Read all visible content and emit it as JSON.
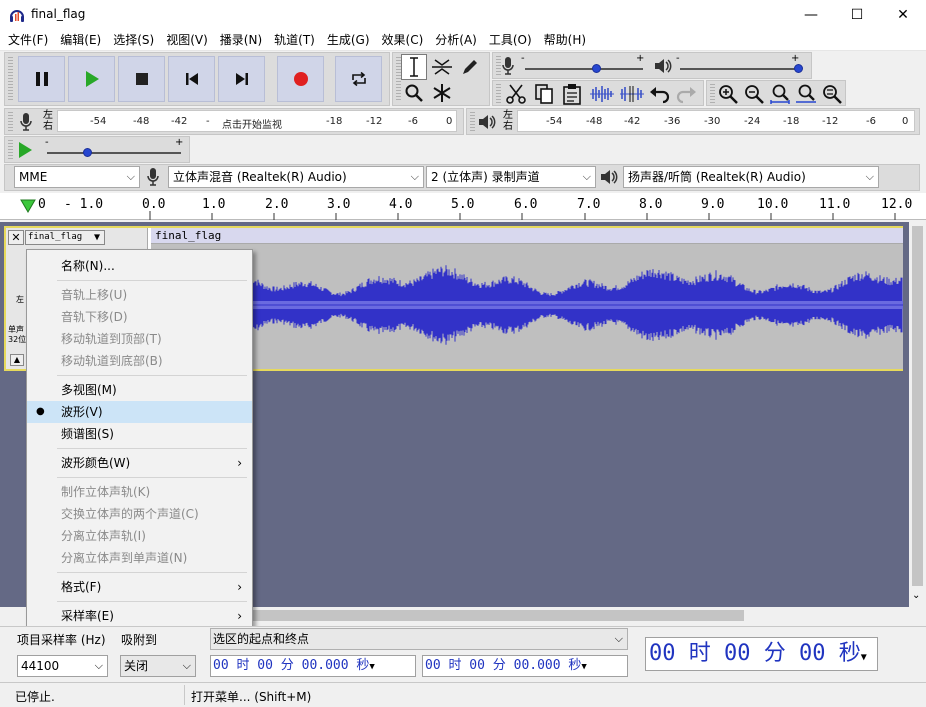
{
  "window": {
    "title": "final_flag",
    "minimize_glyph": "—",
    "maximize_glyph": "☐",
    "close_glyph": "✕"
  },
  "menu": [
    "文件(F)",
    "编辑(E)",
    "选择(S)",
    "视图(V)",
    "播录(N)",
    "轨道(T)",
    "生成(G)",
    "效果(C)",
    "分析(A)",
    "工具(O)",
    "帮助(H)"
  ],
  "meters": {
    "record": {
      "lr": "左右",
      "prompt": "点击开始监视",
      "ticks": [
        "-54",
        "-48",
        "-42",
        "-",
        "-18",
        "-12",
        "-6",
        "0"
      ]
    },
    "play": {
      "lr": "左右",
      "ticks": [
        "-54",
        "-48",
        "-42",
        "-36",
        "-30",
        "-24",
        "-18",
        "-12",
        "-6",
        "0"
      ]
    }
  },
  "mixer": {
    "minus": "-",
    "plus": "+",
    "record_level": 0.6,
    "play_level": 1.0,
    "speed_level": 0.3
  },
  "devices": {
    "host": "MME",
    "recording_device": "立体声混音 (Realtek(R) Audio)",
    "channels": "2 (立体声) 录制声道",
    "playback_device": "扬声器/听筒 (Realtek(R) Audio)"
  },
  "timeline": {
    "labels": [
      "0",
      "- 1.0",
      "0.0",
      "1.0",
      "2.0",
      "3.0",
      "4.0",
      "5.0",
      "6.0",
      "7.0",
      "8.0",
      "9.0",
      "10.0",
      "11.0",
      "12.0"
    ]
  },
  "track": {
    "name": "final_flag",
    "clip_name": "final_flag",
    "ctrl_mono": "单声",
    "ctrl_rate": "32位",
    "ctrl_l": "左"
  },
  "context_menu": {
    "items": [
      {
        "label": "名称(N)...",
        "disabled": false
      },
      {
        "label": "音轨上移(U)",
        "disabled": true
      },
      {
        "label": "音轨下移(D)",
        "disabled": true
      },
      {
        "label": "移动轨道到顶部(T)",
        "disabled": true
      },
      {
        "label": "移动轨道到底部(B)",
        "disabled": true
      },
      {
        "label": "多视图(M)",
        "disabled": false
      },
      {
        "label": "波形(V)",
        "disabled": false,
        "checked": true
      },
      {
        "label": "频谱图(S)",
        "disabled": false
      },
      {
        "label": "波形颜色(W)",
        "disabled": false,
        "submenu": true
      },
      {
        "label": "制作立体声轨(K)",
        "disabled": true
      },
      {
        "label": "交换立体声的两个声道(C)",
        "disabled": true
      },
      {
        "label": "分离立体声轨(I)",
        "disabled": true
      },
      {
        "label": "分离立体声到单声道(N)",
        "disabled": true
      },
      {
        "label": "格式(F)",
        "disabled": false,
        "submenu": true
      },
      {
        "label": "采样率(E)",
        "disabled": false,
        "submenu": true
      }
    ]
  },
  "selection_toolbar": {
    "rate_label": "项目采样率 (Hz)",
    "snap_label": "吸附到",
    "rate_value": "44100",
    "snap_value": "关闭",
    "mode": "选区的起点和终点",
    "start_time": "00 时 00 分 00.000 秒",
    "end_time": "00 时 00 分 00.000 秒",
    "position": "00 时 00 分 00 秒"
  },
  "status": {
    "state": "已停止.",
    "hint": "打开菜单... (Shift+M)"
  },
  "colors": {
    "waveform": "#3232c8",
    "track_bg": "#646985",
    "selected_border": "#e6d95c"
  }
}
